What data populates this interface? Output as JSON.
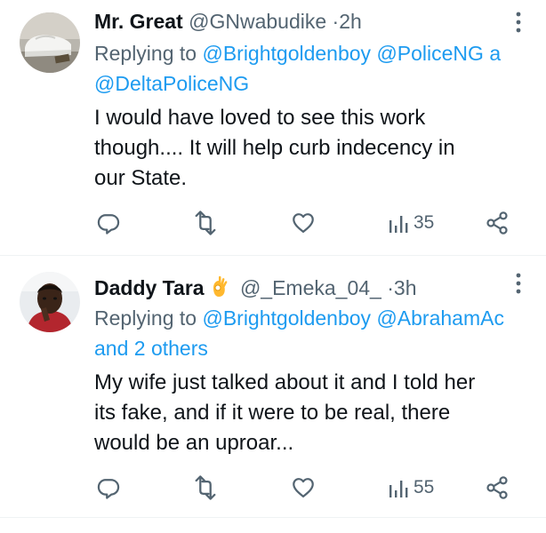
{
  "tweets": [
    {
      "name": "Mr. Great",
      "handle": "@GNwabudike",
      "separator": "·",
      "time": "2h",
      "replying_prefix": "Replying to",
      "replying_mentions_line1": "@Brightgoldenboy @PoliceNG a",
      "replying_mentions_line2": "@DeltaPoliceNG",
      "text_lines": [
        "I would have loved to see this work",
        "though.... It will help curb indecency in",
        "our State."
      ],
      "views": "35",
      "icons": [
        "reply-icon",
        "retweet-icon",
        "like-icon",
        "views-icon",
        "share-icon"
      ]
    },
    {
      "name": "Daddy Tara",
      "emoji": "ok-hand-emoji",
      "handle": "@_Emeka_04_",
      "separator": "·",
      "time": "3h",
      "replying_prefix": "Replying to",
      "replying_mentions_line1": "@Brightgoldenboy @AbrahamAc",
      "replying_mentions_line2": "and 2 others",
      "text_lines": [
        "My wife just talked about it and I told her",
        "its fake, and if it were to be real, there",
        "would be an uproar..."
      ],
      "views": "55",
      "icons": [
        "reply-icon",
        "retweet-icon",
        "like-icon",
        "views-icon",
        "share-icon"
      ]
    }
  ],
  "colors": {
    "text": "#0f1419",
    "secondary": "#536471",
    "link": "#1d9bf0",
    "divider": "#eff3f4"
  }
}
